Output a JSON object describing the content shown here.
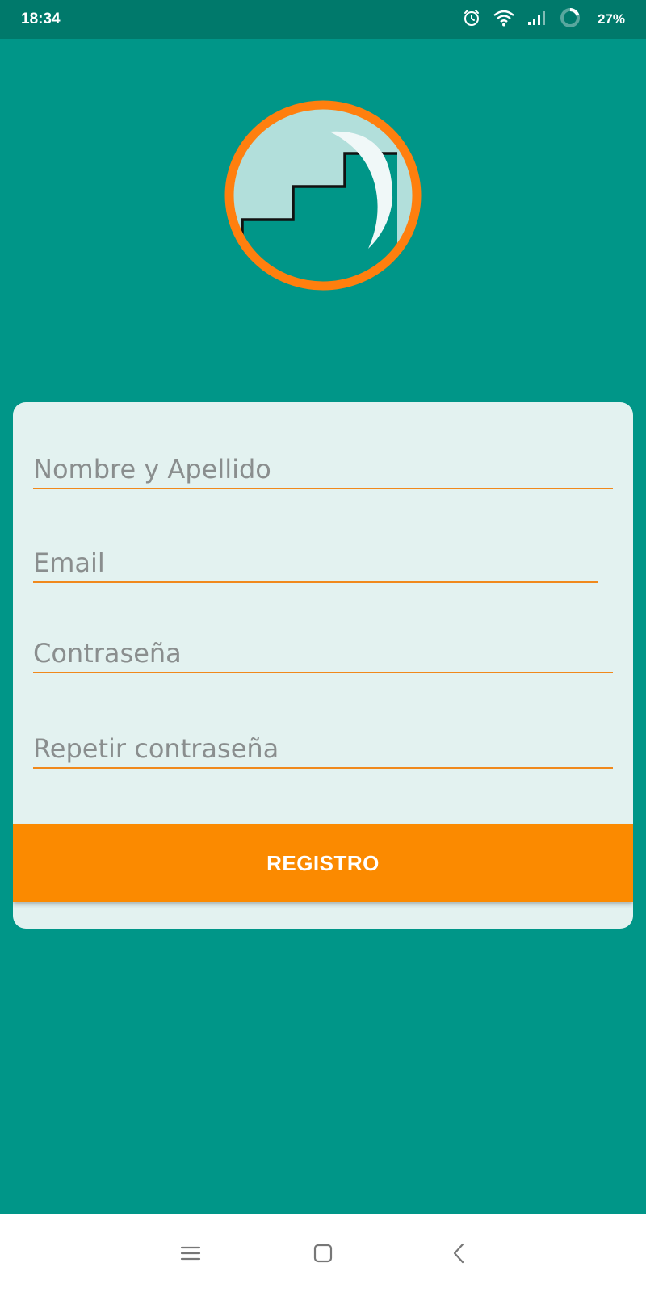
{
  "status_bar": {
    "time": "18:34",
    "battery": "27%",
    "icons": [
      "alarm-icon",
      "wifi-icon",
      "signal-icon",
      "battery-ring-icon"
    ]
  },
  "logo": {
    "icon": "stairs-moon-logo",
    "ring_color": "#ff7f0e",
    "inner_color": "#b2dfdb"
  },
  "form": {
    "name_placeholder": "Nombre y Apellido",
    "email_placeholder": "Email",
    "password_placeholder": "Contraseña",
    "repeat_password_placeholder": "Repetir contraseña",
    "submit_label": "REGISTRO"
  },
  "nav_bar": {
    "icons": [
      "menu-icon",
      "home-icon",
      "back-icon"
    ]
  },
  "colors": {
    "background": "#009688",
    "status_bar": "#00796b",
    "card": "#e3f2f0",
    "accent": "#fb8a00",
    "underline": "#f0891c"
  }
}
